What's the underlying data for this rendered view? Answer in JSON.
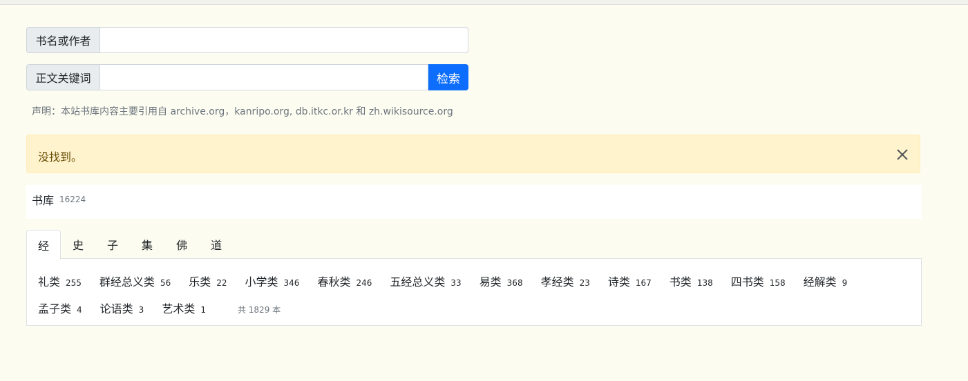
{
  "search": {
    "title_author_label": "书名或作者",
    "title_author_value": "",
    "fulltext_label": "正文关键词",
    "fulltext_value": "",
    "search_button": "检索"
  },
  "disclaimer": "声明：本站书库内容主要引用自 archive.org，kanripo.org, db.itkc.or.kr 和 zh.wikisource.org",
  "alert": {
    "message": "没找到。",
    "close_icon": "close-icon"
  },
  "library": {
    "title": "书库",
    "count": "16224"
  },
  "tabs": [
    "经",
    "史",
    "子",
    "集",
    "佛",
    "道"
  ],
  "active_tab": "经",
  "categories_row1": [
    {
      "name": "礼类",
      "count": "255"
    },
    {
      "name": "群经总义类",
      "count": "56"
    },
    {
      "name": "乐类",
      "count": "22"
    },
    {
      "name": "小学类",
      "count": "346"
    },
    {
      "name": "春秋类",
      "count": "246"
    },
    {
      "name": "五经总义类",
      "count": "33"
    },
    {
      "name": "易类",
      "count": "368"
    },
    {
      "name": "孝经类",
      "count": "23"
    },
    {
      "name": "诗类",
      "count": "167"
    },
    {
      "name": "书类",
      "count": "138"
    },
    {
      "name": "四书类",
      "count": "158"
    },
    {
      "name": "经解类",
      "count": "9"
    }
  ],
  "categories_row2": [
    {
      "name": "孟子类",
      "count": "4"
    },
    {
      "name": "论语类",
      "count": "3"
    },
    {
      "name": "艺术类",
      "count": "1"
    }
  ],
  "total": "共 1829 本",
  "colors": {
    "background": "#fcfcf0",
    "primary_button": "#0d6efd",
    "alert_bg": "#fff3cd",
    "alert_text": "#664d03"
  }
}
